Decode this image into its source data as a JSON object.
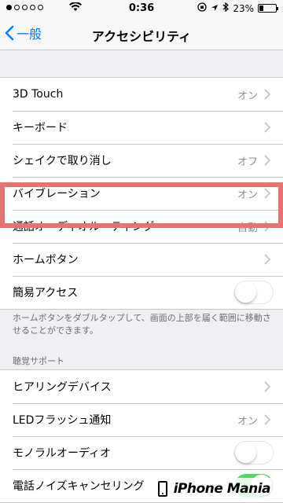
{
  "status_bar": {
    "time": "0:36",
    "battery": "23%",
    "battery_level": 0.23
  },
  "nav": {
    "back_label": "一般",
    "title": "アクセシビリティ"
  },
  "group1": {
    "items": [
      {
        "label": "3D Touch",
        "value": "オン"
      },
      {
        "label": "キーボード",
        "value": ""
      },
      {
        "label": "シェイクで取り消し",
        "value": "オフ"
      },
      {
        "label": "バイブレーション",
        "value": "オン"
      },
      {
        "label": "通話オーディオルーティング",
        "value": "自動"
      },
      {
        "label": "ホームボタン",
        "value": ""
      },
      {
        "label": "簡易アクセス",
        "toggle": false
      }
    ]
  },
  "group1_footer": "ホームボタンをダブルタップして、画面の上部を届く範囲に移動させることができます。",
  "hearing_header": "聴覚サポート",
  "group2": {
    "items": [
      {
        "label": "ヒアリングデバイス",
        "value": ""
      },
      {
        "label": "LEDフラッシュ通知",
        "value": "オン"
      },
      {
        "label": "モノラルオーディオ",
        "toggle": false
      },
      {
        "label": "電話ノイズキャンセリング",
        "toggle": true
      }
    ]
  },
  "watermark": {
    "text": "iPhone Mania"
  },
  "colors": {
    "accent": "#007aff",
    "highlight": "#e57373",
    "toggle_on": "#4cd964"
  }
}
